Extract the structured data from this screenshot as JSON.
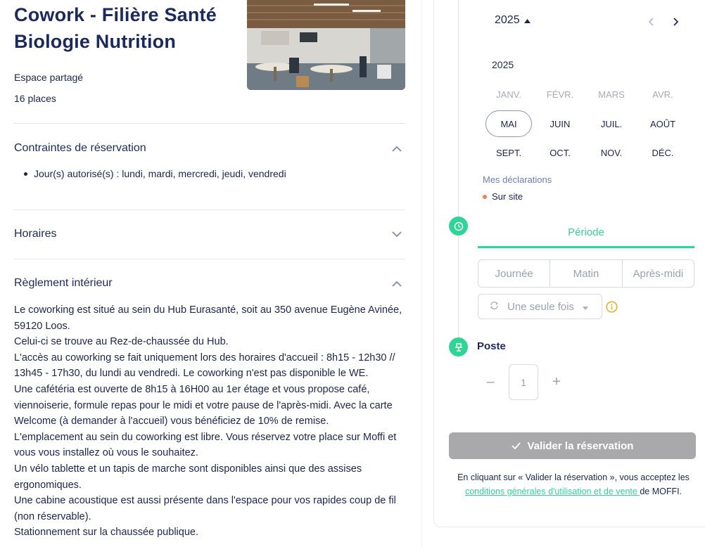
{
  "space": {
    "title": "Cowork - Filière Santé Biologie Nutrition",
    "type": "Espace partagé",
    "capacity": "16 places"
  },
  "sections": {
    "constraints": {
      "title": "Contraintes de réservation",
      "items": [
        "Jour(s) autorisé(s) : lundi, mardi, mercredi, jeudi, vendredi"
      ]
    },
    "hours": {
      "title": "Horaires"
    },
    "rules": {
      "title": "Règlement intérieur",
      "paragraphs": [
        "Le coworking est situé au sein du Hub Eurasanté, soit au 350 avenue Eugène Avinée, 59120 Loos.",
        "Celui-ci se trouve au Rez-de-chaussée du Hub.",
        "L'accès au coworking se fait uniquement lors des horaires d'accueil : 8h15 - 12h30 // 13h45 - 17h30, du lundi au vendredi. Le coworking n'est pas disponible le WE.",
        "Une cafétéria est ouverte de 8h15 à 16H00 au 1er étage et vous propose café, viennoiserie, formule repas pour le midi et votre pause de l'après-midi. Avec la carte Welcome (à demander à l'accueil) vous bénéficiez de 10% de remise.",
        "L'emplacement au sein du coworking est libre. Vous réservez votre place sur Moffi et vous vous installez où vous le souhaitez.",
        "Un vélo tablette et un tapis de marche sont disponibles ainsi que des assises ergonomiques.",
        "Une cabine acoustique est aussi présente dans l'espace pour vos rapides coup de fil (non réservable).",
        "Stationnement sur la chaussée publique."
      ]
    }
  },
  "calendar": {
    "year_selector": "2025",
    "year_label": "2025",
    "months": [
      {
        "label": "JANV.",
        "state": "disabled"
      },
      {
        "label": "FÉVR.",
        "state": "disabled"
      },
      {
        "label": "MARS",
        "state": "disabled"
      },
      {
        "label": "AVR.",
        "state": "disabled"
      },
      {
        "label": "MAI",
        "state": "selected"
      },
      {
        "label": "JUIN",
        "state": "normal"
      },
      {
        "label": "JUIL.",
        "state": "normal"
      },
      {
        "label": "AOÛT",
        "state": "normal"
      },
      {
        "label": "SEPT.",
        "state": "normal"
      },
      {
        "label": "OCT.",
        "state": "normal"
      },
      {
        "label": "NOV.",
        "state": "normal"
      },
      {
        "label": "DÉC.",
        "state": "normal"
      }
    ],
    "declarations_label": "Mes déclarations",
    "legend": [
      {
        "label": "Sur site",
        "color": "#e8825a"
      }
    ]
  },
  "period": {
    "tab_label": "Période",
    "options": [
      "Journée",
      "Matin",
      "Après-midi"
    ],
    "recurrence": "Une seule fois"
  },
  "desk": {
    "label": "Poste",
    "quantity": "1",
    "minus": "–",
    "plus": "+"
  },
  "actions": {
    "validate_label": "Valider la réservation",
    "legal_prefix": "En cliquant sur « Valider la réservation », vous acceptez les ",
    "legal_link": "conditions générales d'utilisation et de vente ",
    "legal_suffix": "de MOFFI."
  },
  "colors": {
    "accent": "#2ed597",
    "primary_text": "#1b2a5c",
    "disabled_button": "#a9a9ab"
  }
}
